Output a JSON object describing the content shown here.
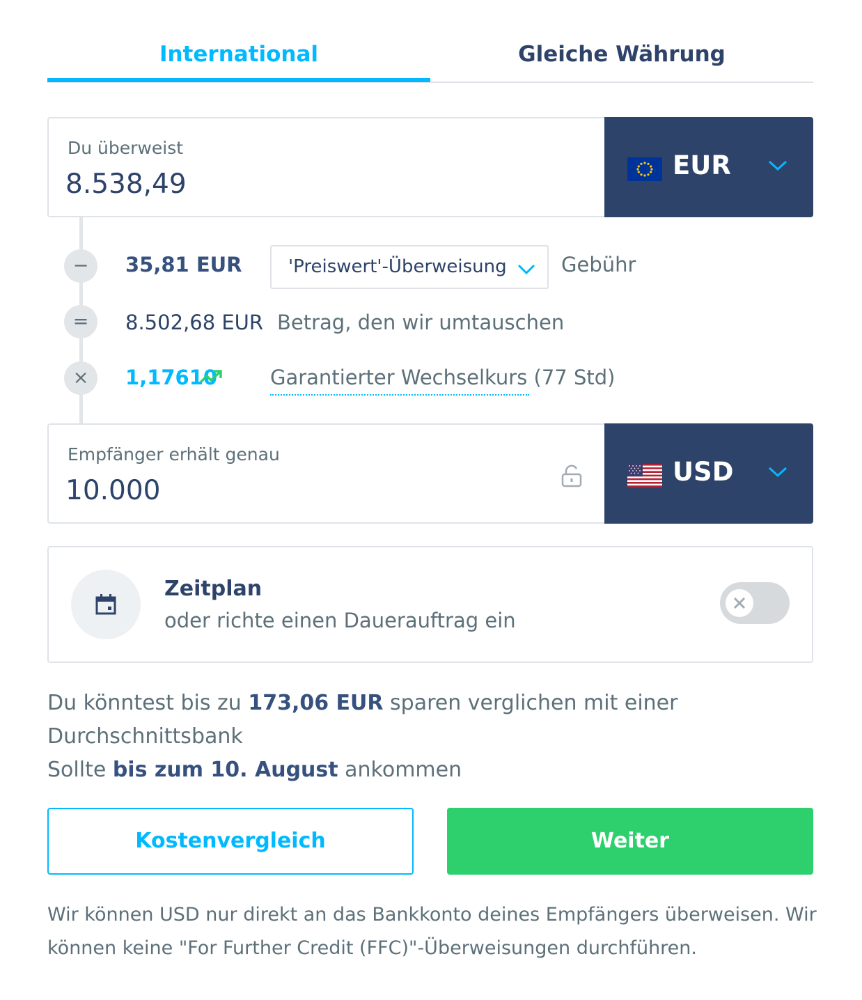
{
  "tabs": [
    {
      "label": "International",
      "active": true
    },
    {
      "label": "Gleiche Währung",
      "active": false
    }
  ],
  "send": {
    "label": "Du überweist",
    "value": "8.538,49",
    "currency": "EUR",
    "flag": "eu-flag-icon"
  },
  "breakdown": {
    "fee_amount": "35,81 EUR",
    "fee_option": "'Preiswert'-Überweisung",
    "fee_label": "Gebühr",
    "converted_amount": "8.502,68 EUR",
    "converted_label": "Betrag, den wir umtauschen",
    "rate": "1,17610",
    "rate_label": "Garantierter Wechselkurs (77 Std)",
    "symbols": {
      "minus": "−",
      "equals": "=",
      "times": "×"
    }
  },
  "receive": {
    "label": "Empfänger erhält genau",
    "value": "10.000",
    "currency": "USD",
    "flag": "us-flag-icon"
  },
  "schedule": {
    "title": "Zeitplan",
    "subtitle": "oder richte einen Dauerauftrag ein",
    "enabled": false
  },
  "savings": {
    "prefix": "Du könntest bis zu ",
    "amount": "173,06 EUR",
    "suffix": " sparen verglichen mit einer Durchschnittsbank"
  },
  "arrival": {
    "prefix": "Sollte ",
    "date": "bis zum 10. August",
    "suffix": " ankommen"
  },
  "buttons": {
    "compare": "Kostenvergleich",
    "next": "Weiter"
  },
  "footnote": "Wir können USD nur direkt an das Bankkonto deines Empfängers überweisen. Wir können keine \"For Further Credit (FFC)\"-Überweisungen durchführen.",
  "colors": {
    "accent": "#00b9ff",
    "navy": "#2e4369",
    "green": "#2ed06e",
    "muted": "#5d7079"
  }
}
